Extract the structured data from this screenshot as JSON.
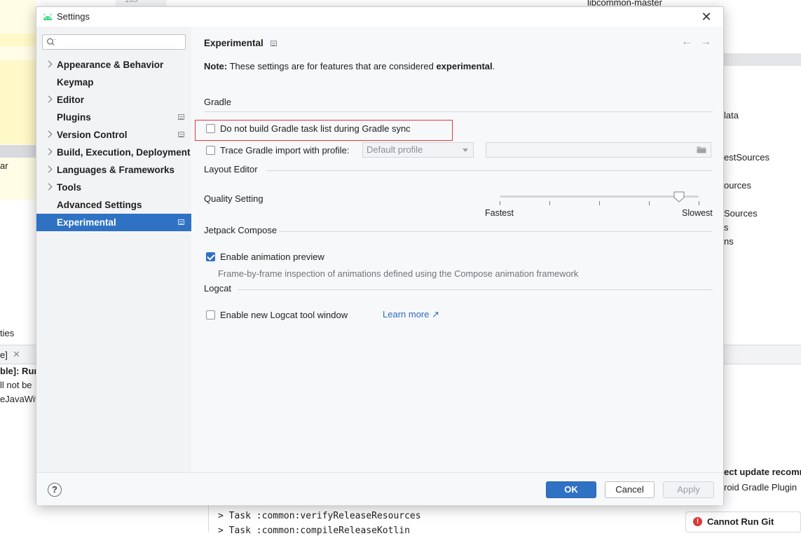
{
  "background": {
    "line_number": "165",
    "project_name": "libcommon-master",
    "right_items": [
      "lata",
      "estSources",
      "ources",
      "Sources",
      "s",
      "ns"
    ],
    "left_text": "ar",
    "left_ties": "ties",
    "left_tab": "e]",
    "left_lines": [
      "ble]: Run",
      "ll not be",
      "eJavaWith"
    ],
    "console_lines": [
      "> Task :common:verifyReleaseResources",
      "> Task :common:compileReleaseKotlin"
    ],
    "notif_title": "ect update recomm",
    "notif_body": "roid Gradle Plugin",
    "cannot_run_git": "Cannot Run Git"
  },
  "dialog": {
    "title": "Settings",
    "close_glyph": "✕"
  },
  "sidebar": {
    "search_placeholder": "",
    "items": [
      {
        "label": "Appearance & Behavior",
        "expandable": true,
        "project": false
      },
      {
        "label": "Keymap",
        "expandable": false,
        "project": false
      },
      {
        "label": "Editor",
        "expandable": true,
        "project": false
      },
      {
        "label": "Plugins",
        "expandable": false,
        "project": true
      },
      {
        "label": "Version Control",
        "expandable": true,
        "project": true
      },
      {
        "label": "Build, Execution, Deployment",
        "expandable": true,
        "project": false
      },
      {
        "label": "Languages & Frameworks",
        "expandable": true,
        "project": false
      },
      {
        "label": "Tools",
        "expandable": true,
        "project": false
      },
      {
        "label": "Advanced Settings",
        "expandable": false,
        "project": false
      },
      {
        "label": "Experimental",
        "expandable": false,
        "project": true,
        "selected": true
      }
    ]
  },
  "content": {
    "title": "Experimental",
    "back_arrow": "←",
    "forward_arrow": "→",
    "note_prefix": "Note:",
    "note_text": " These settings are for features that are considered ",
    "note_bold": "experimental",
    "note_end": ".",
    "gradle": {
      "heading": "Gradle",
      "do_not_build_label": "Do not build Gradle task list during Gradle sync",
      "do_not_build_checked": false,
      "trace_label": "Trace Gradle import with profile:",
      "trace_checked": false,
      "profile_value": "Default profile",
      "profile_path": ""
    },
    "layout_editor": {
      "heading": "Layout Editor",
      "quality_label": "Quality Setting",
      "min_label": "Fastest",
      "max_label": "Slowest",
      "level_fraction": 0.9
    },
    "compose": {
      "heading": "Jetpack Compose",
      "animation_label": "Enable animation preview",
      "animation_checked": true,
      "animation_desc": "Frame-by-frame inspection of animations defined using the Compose animation framework"
    },
    "logcat": {
      "heading": "Logcat",
      "new_window_label": "Enable new Logcat tool window",
      "new_window_checked": false,
      "learn_more": "Learn more ↗"
    }
  },
  "footer": {
    "help_glyph": "?",
    "ok": "OK",
    "cancel": "Cancel",
    "apply": "Apply"
  },
  "colors": {
    "accent": "#2f72c4",
    "highlight_border": "#e03a3a",
    "link": "#2a6dc1",
    "error": "#d93a3a"
  }
}
